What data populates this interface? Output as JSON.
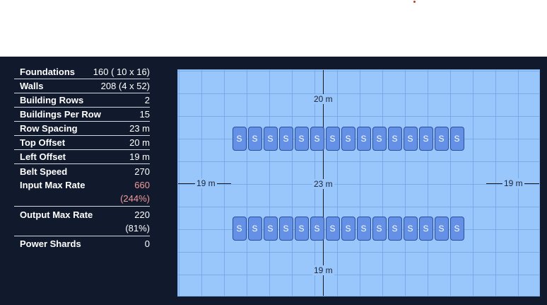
{
  "stats": {
    "foundations": {
      "label": "Foundations",
      "value": "160 ( 10 x 16)"
    },
    "walls": {
      "label": "Walls",
      "value": "208 (4 x 52)"
    },
    "building_rows": {
      "label": "Building Rows",
      "value": "2"
    },
    "buildings_per_row": {
      "label": "Buildings Per Row",
      "value": "15"
    },
    "row_spacing": {
      "label": "Row Spacing",
      "value": "23 m"
    },
    "top_offset": {
      "label": "Top Offset",
      "value": "20 m"
    },
    "left_offset": {
      "label": "Left Offset",
      "value": "19 m"
    },
    "belt_speed": {
      "label": "Belt Speed",
      "value": "270"
    },
    "input_max_rate": {
      "label": "Input Max Rate",
      "value": "660",
      "percent": "(244%)"
    },
    "output_max_rate": {
      "label": "Output Max Rate",
      "value": "220",
      "percent": "(81%)"
    },
    "power_shards": {
      "label": "Power Shards",
      "value": "0"
    }
  },
  "diagram": {
    "top_offset_label": "20 m",
    "row_spacing_label": "23 m",
    "bottom_offset_label": "19 m",
    "left_offset_label": "19 m",
    "right_offset_label": "19 m",
    "building_label": "S",
    "rows": 2,
    "buildings_per_row": 15
  },
  "colors": {
    "panel_bg": "#111a2d",
    "grid_bg": "#99c6fb",
    "building_fill": "#6490e6",
    "warn_text": "#f49a9a"
  }
}
